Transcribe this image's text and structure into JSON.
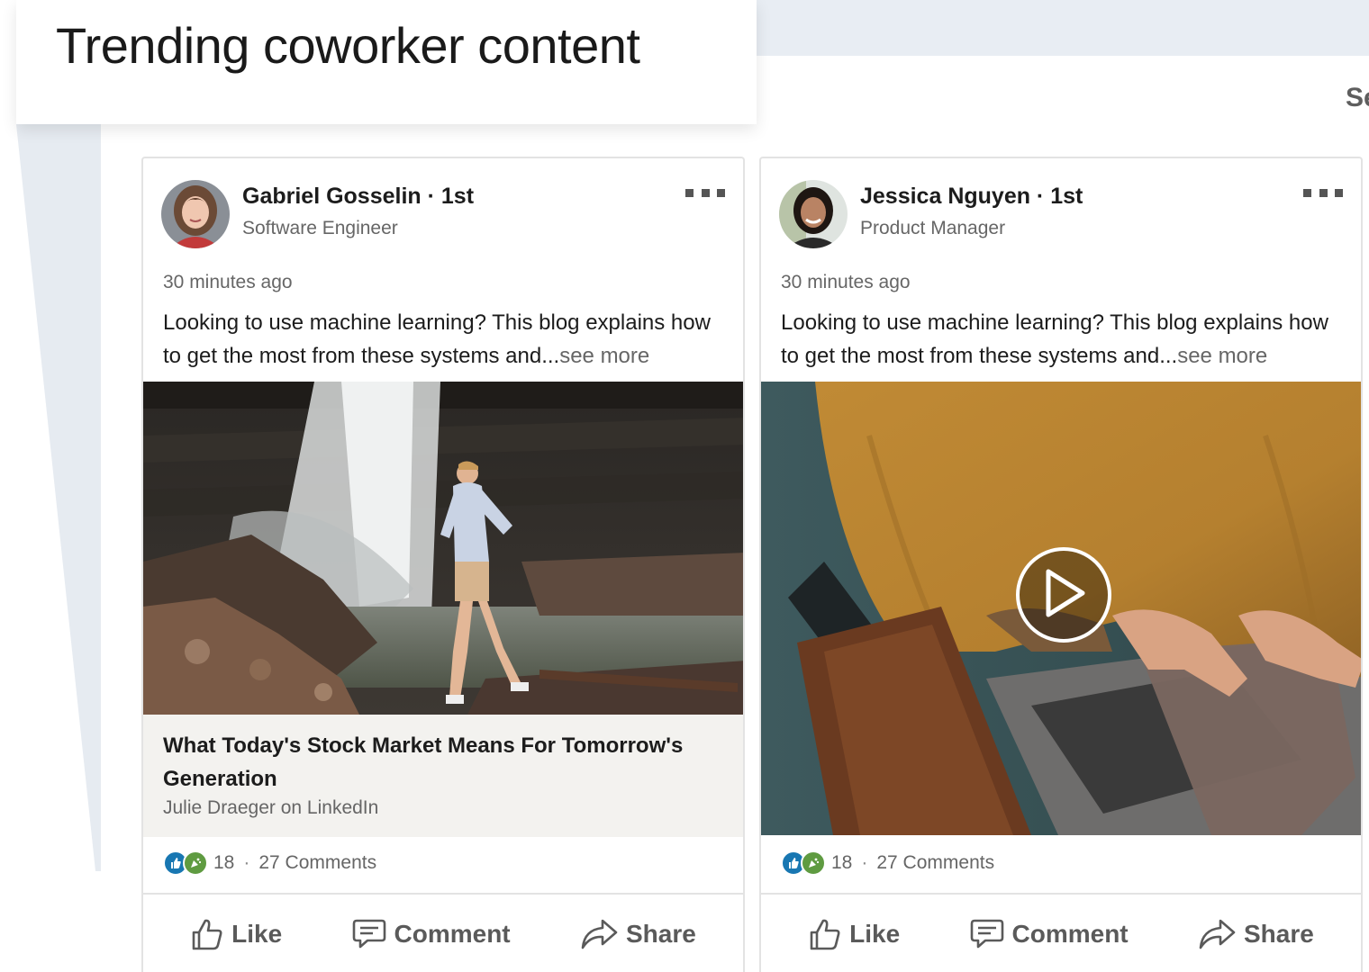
{
  "page": {
    "title": "Trending coworker content",
    "see_all_partial": "Se"
  },
  "posts": [
    {
      "author": "Gabriel Gosselin · 1st",
      "headline": "Software Engineer",
      "time": "30 minutes ago",
      "text": "Looking to use machine learning? This blog explains how to get the most from these systems and...",
      "see_more": "see more",
      "media": "photo of a man walking near a waterfall",
      "article": {
        "title": "What Today's Stock Market Means For Tomorrow's Generation",
        "source": "Julie Draeger on LinkedIn"
      },
      "reaction_icons": [
        "like-icon",
        "celebrate-icon"
      ],
      "reaction_count": "18",
      "comments": "27 Comments",
      "actions": {
        "like": "Like",
        "comment": "Comment",
        "share": "Share"
      }
    },
    {
      "author": "Jessica Nguyen · 1st",
      "headline": "Product Manager",
      "time": "30 minutes ago",
      "text": "Looking to use machine learning? This blog explains how to get the most from these systems and...",
      "see_more": "see more",
      "media": "video of a person in a mustard sweater typing on a laptop",
      "reaction_icons": [
        "like-icon",
        "celebrate-icon"
      ],
      "reaction_count": "18",
      "comments": "27 Comments",
      "actions": {
        "like": "Like",
        "comment": "Comment",
        "share": "Share"
      }
    }
  ],
  "colors": {
    "like_blue": "#1877b2",
    "celebrate_green": "#5f9b41",
    "band": "#e8edf3",
    "article_bg": "#f3f2ef"
  }
}
